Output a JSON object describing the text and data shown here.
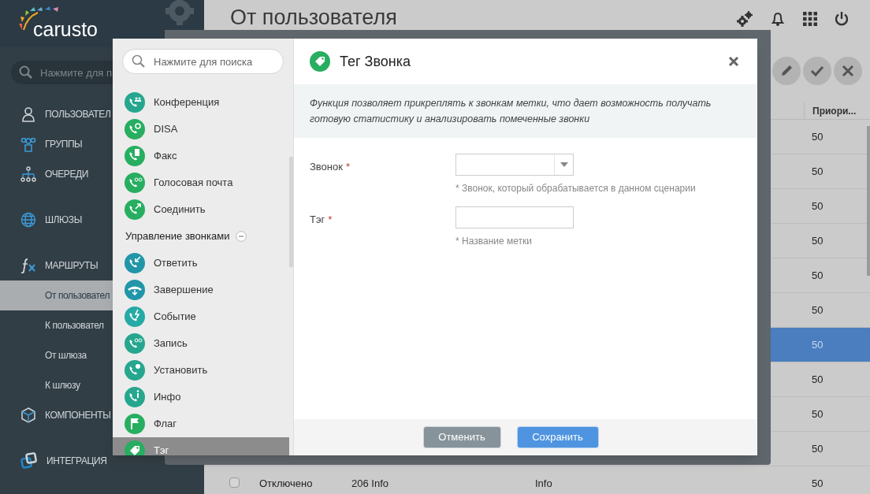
{
  "sidebar": {
    "logo": "carusto",
    "search": {
      "placeholder": "Нажмите для п"
    },
    "items": [
      {
        "kind": "section",
        "label": "ПОЛЬЗОВАТЕЛ",
        "selected": false
      },
      {
        "kind": "section",
        "label": "ГРУППЫ",
        "selected": false
      },
      {
        "kind": "section",
        "label": "ОЧЕРЕДИ",
        "selected": false
      },
      {
        "kind": "section",
        "label": "ШЛЮЗЫ",
        "selected": false
      },
      {
        "kind": "section",
        "label": "МАРШРУТЫ",
        "selected": false
      },
      {
        "kind": "subitem",
        "label": "От пользовател",
        "selected": true
      },
      {
        "kind": "subitem",
        "label": "К пользовател",
        "selected": false
      },
      {
        "kind": "subitem",
        "label": "От шлюза",
        "selected": false
      },
      {
        "kind": "subitem",
        "label": "К шлюзу",
        "selected": false
      },
      {
        "kind": "section",
        "label": "КОМПОНЕНТЫ",
        "selected": false
      },
      {
        "kind": "section",
        "label": "ИНТЕГРАЦИЯ",
        "selected": false
      }
    ]
  },
  "page": {
    "title": "От пользователя"
  },
  "table": {
    "header": "Приори...",
    "rows": [
      {
        "cells": [
          "50"
        ],
        "selected": false
      },
      {
        "cells": [
          "50"
        ],
        "selected": false
      },
      {
        "cells": [
          "50"
        ],
        "selected": false
      },
      {
        "cells": [
          "50"
        ],
        "selected": false
      },
      {
        "cells": [
          "50"
        ],
        "selected": false
      },
      {
        "cells": [
          "50"
        ],
        "selected": false
      },
      {
        "cells": [
          "50"
        ],
        "selected": true
      },
      {
        "cells": [
          "50"
        ],
        "selected": false
      },
      {
        "cells": [
          "50"
        ],
        "selected": false
      },
      {
        "cells": [
          "50"
        ],
        "selected": false
      },
      {
        "cells": [
          "Отключено",
          "206 Info",
          "Info",
          "50"
        ],
        "selected": false,
        "checked": false
      }
    ]
  },
  "palette": {
    "search": {
      "placeholder": "Нажмите для поиска"
    },
    "items": [
      {
        "kind": "item",
        "label": "Конференция",
        "color": "#26a68f",
        "selected": false
      },
      {
        "kind": "item",
        "label": "DISA",
        "color": "#27ae60",
        "selected": false
      },
      {
        "kind": "item",
        "label": "Факс",
        "color": "#27ae60",
        "selected": false
      },
      {
        "kind": "item",
        "label": "Голосовая почта",
        "color": "#27ae60",
        "selected": false
      },
      {
        "kind": "item",
        "label": "Соединить",
        "color": "#27ae60",
        "selected": false
      },
      {
        "kind": "group",
        "label": "Управление звонками",
        "expanded": true
      },
      {
        "kind": "item",
        "label": "Ответить",
        "color": "#2196a8",
        "selected": false
      },
      {
        "kind": "item",
        "label": "Завершение",
        "color": "#2196a8",
        "selected": false
      },
      {
        "kind": "item",
        "label": "Событие",
        "color": "#26aaa5",
        "selected": false
      },
      {
        "kind": "item",
        "label": "Запись",
        "color": "#26a68f",
        "selected": false
      },
      {
        "kind": "item",
        "label": "Установить",
        "color": "#26a68f",
        "selected": false
      },
      {
        "kind": "item",
        "label": "Инфо",
        "color": "#26a68f",
        "selected": false
      },
      {
        "kind": "item",
        "label": "Флаг",
        "color": "#27ae60",
        "selected": false
      },
      {
        "kind": "item",
        "label": "Тэг",
        "color": "#27ae60",
        "selected": true
      }
    ]
  },
  "dialog": {
    "title": "Тег Звонка",
    "description": "Функция позволяет прикреплять к звонкам метки, что дает возможность получать готовую статистику и анализировать помеченные звонки",
    "fields": [
      {
        "kind": "select",
        "label": "Звонок",
        "required_mark": "*",
        "hint": "* Звонок, который обрабатывается в данном сценарии"
      },
      {
        "kind": "text",
        "label": "Тэг",
        "required_mark": "*",
        "hint": "* Название метки"
      }
    ],
    "buttons": [
      {
        "kind": "secondary",
        "label": "Отменить"
      },
      {
        "kind": "primary",
        "label": "Сохранить"
      }
    ]
  }
}
